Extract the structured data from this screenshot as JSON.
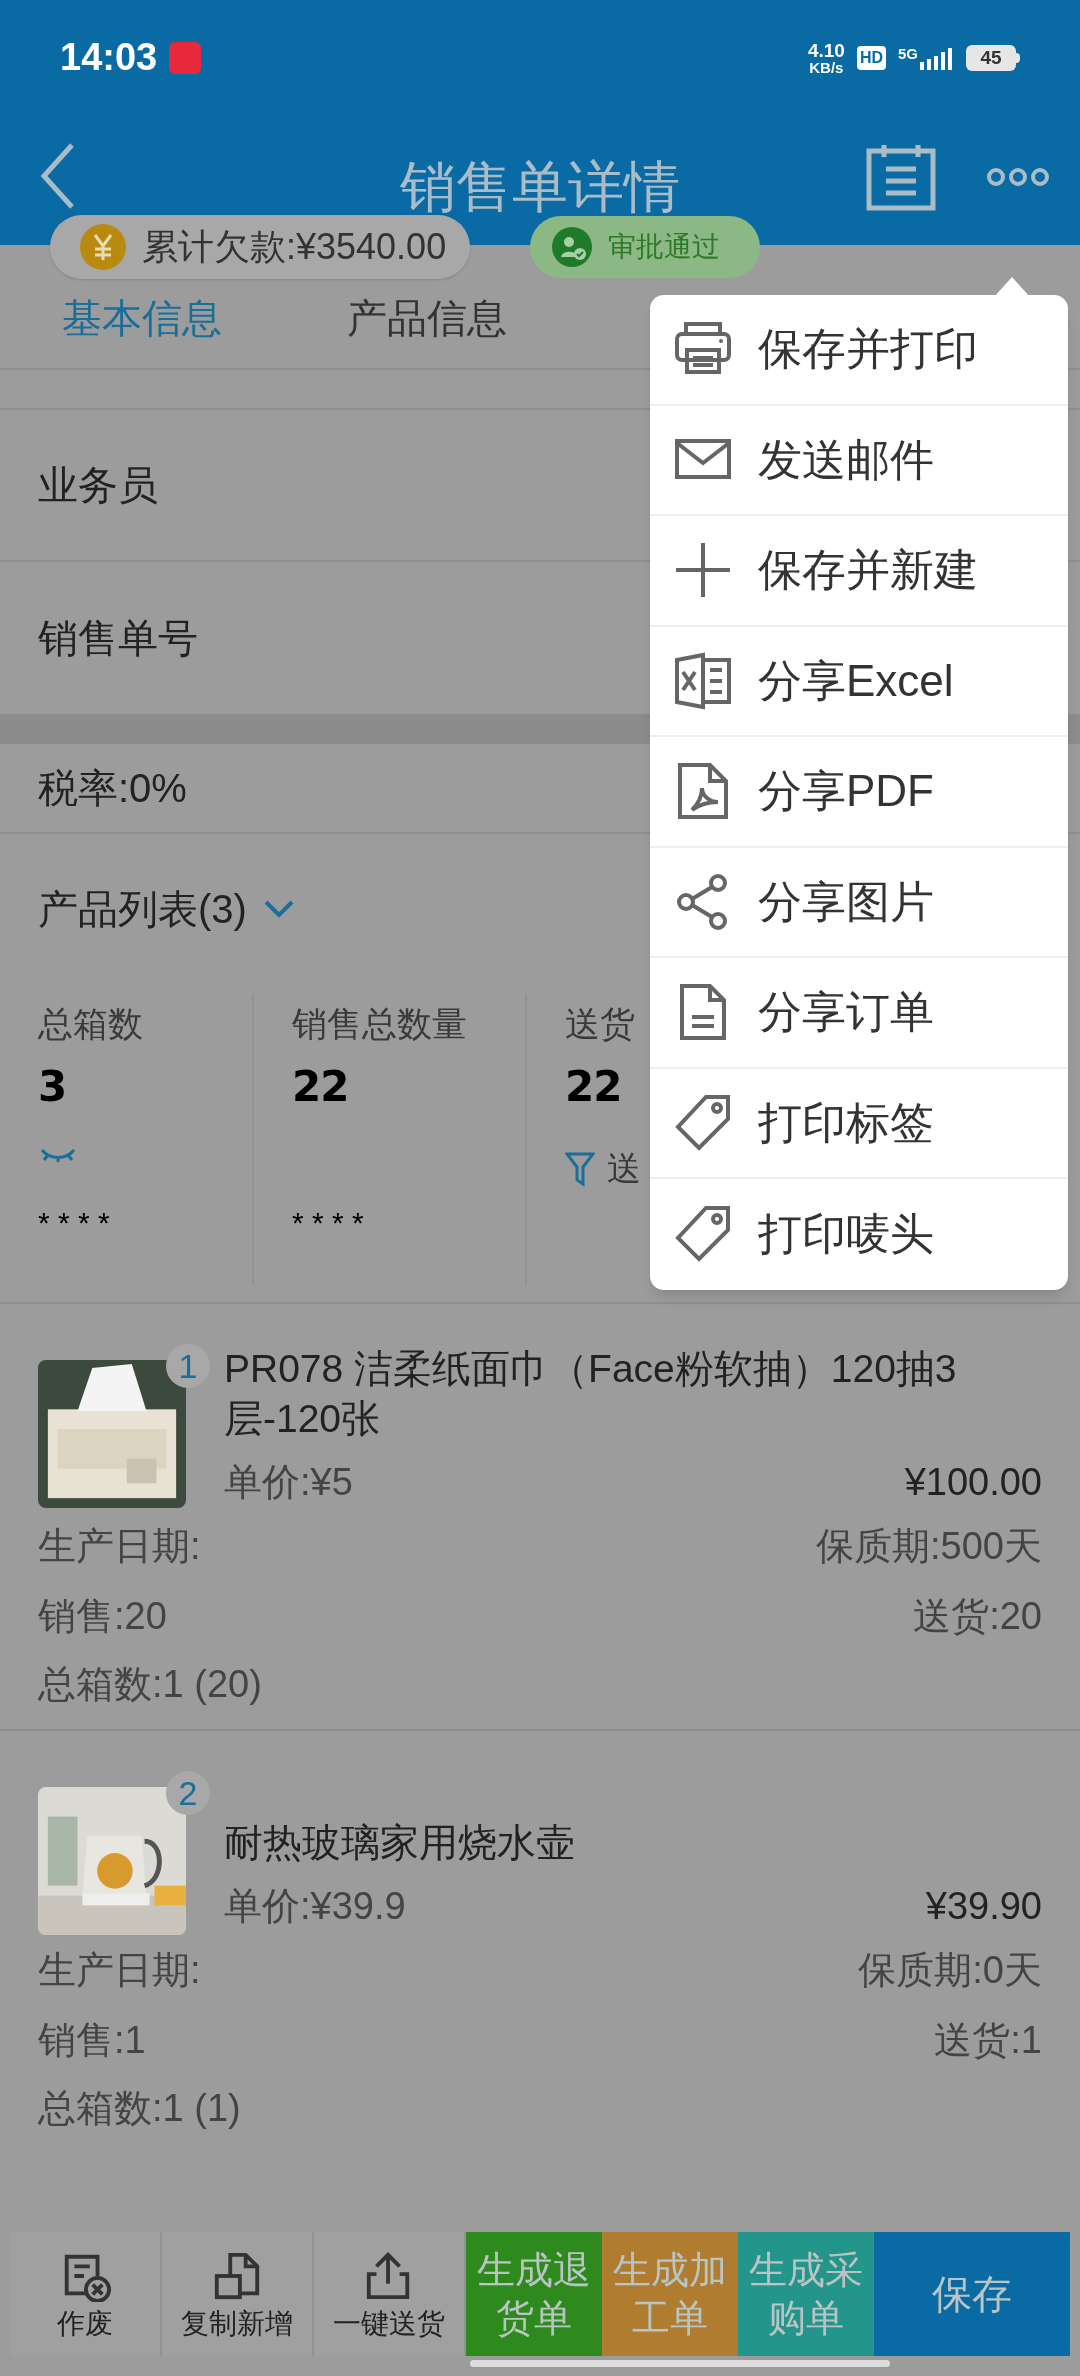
{
  "status_bar": {
    "time": "14:03",
    "net_speed": "4.10",
    "net_unit": "KB/s",
    "hd": "HD",
    "network": "5G",
    "battery": "45"
  },
  "header": {
    "title": "销售单详情"
  },
  "pills": {
    "debt": "累计欠款:¥3540.00",
    "approval": "审批通过"
  },
  "tabs": [
    {
      "label": "基本信息",
      "selected": true
    },
    {
      "label": "产品信息",
      "selected": false
    }
  ],
  "fields": [
    {
      "label": "业务员"
    },
    {
      "label": "销售单号"
    }
  ],
  "tax": "税率:0%",
  "product_list": {
    "title": "产品列表(3)",
    "expanded": true
  },
  "stats": [
    {
      "label": "总箱数",
      "value": "3",
      "hidden_value": "* * * *"
    },
    {
      "label": "销售总数量",
      "value": "22",
      "hidden_value": "* * * *"
    },
    {
      "label": "送货",
      "value": "22",
      "filter": "送"
    }
  ],
  "products": [
    {
      "index": "1",
      "name": "PR078 洁柔纸面巾（Face粉软抽）120抽3层-120张",
      "unit_price": "单价:¥5",
      "amount": "¥100.00",
      "production_date": "生产日期:",
      "shelf_life": "保质期:500天",
      "sold": "销售:20",
      "delivered": "送货:20",
      "boxes": "总箱数:1 (20)"
    },
    {
      "index": "2",
      "name": "耐热玻璃家用烧水壶",
      "unit_price": "单价:¥39.9",
      "amount": "¥39.90",
      "production_date": "生产日期:",
      "shelf_life": "保质期:0天",
      "sold": "销售:1",
      "delivered": "送货:1",
      "boxes": "总箱数:1 (1)"
    }
  ],
  "bottom_bar": [
    {
      "kind": "icon",
      "label": "作废"
    },
    {
      "kind": "icon",
      "label": "复制新增"
    },
    {
      "kind": "icon",
      "label": "一键送货"
    },
    {
      "kind": "colored",
      "label": "生成退货单",
      "color": "#2f8a1d"
    },
    {
      "kind": "colored",
      "label": "生成加工单",
      "color": "#b07c30"
    },
    {
      "kind": "colored",
      "label": "生成采购单",
      "color": "#23958a"
    },
    {
      "kind": "colored",
      "label": "保存",
      "color": "#0a6aa3"
    }
  ],
  "menu": {
    "open": true,
    "items": [
      {
        "label": "保存并打印"
      },
      {
        "label": "发送邮件"
      },
      {
        "label": "保存并新建"
      },
      {
        "label": "分享Excel"
      },
      {
        "label": "分享PDF"
      },
      {
        "label": "分享图片"
      },
      {
        "label": "分享订单"
      },
      {
        "label": "打印标签"
      },
      {
        "label": "打印唛头"
      }
    ]
  }
}
